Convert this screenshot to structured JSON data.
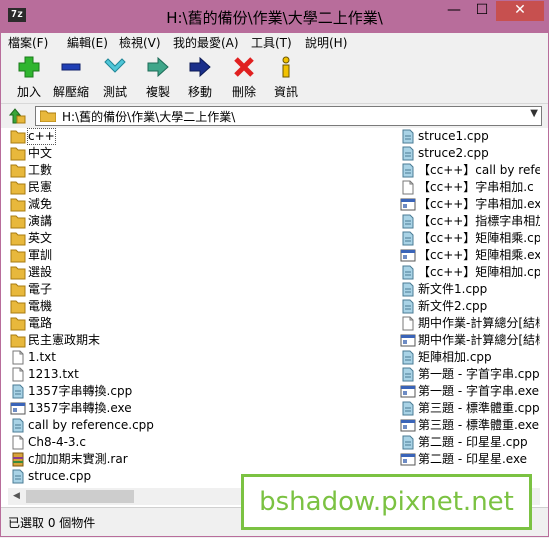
{
  "window": {
    "app_icon": "7z",
    "title": "H:\\舊的備份\\作業\\大學二上作業\\",
    "minimize": "—",
    "maximize": "☐",
    "close": "✕"
  },
  "menu": [
    "檔案(F)",
    "編輯(E)",
    "檢視(V)",
    "我的最愛(A)",
    "工具(T)",
    "說明(H)"
  ],
  "toolbar": [
    {
      "label": "加入",
      "icon": "add-icon"
    },
    {
      "label": "解壓縮",
      "icon": "extract-icon"
    },
    {
      "label": "測試",
      "icon": "test-icon"
    },
    {
      "label": "複製",
      "icon": "copy-icon"
    },
    {
      "label": "移動",
      "icon": "move-icon"
    },
    {
      "label": "刪除",
      "icon": "delete-icon"
    },
    {
      "label": "資訊",
      "icon": "info-icon"
    }
  ],
  "address": {
    "path": "H:\\舊的備份\\作業\\大學二上作業\\"
  },
  "files_left": [
    {
      "name": "c++",
      "type": "folder"
    },
    {
      "name": "中文",
      "type": "folder"
    },
    {
      "name": "工數",
      "type": "folder"
    },
    {
      "name": "民憲",
      "type": "folder"
    },
    {
      "name": "減免",
      "type": "folder"
    },
    {
      "name": "演講",
      "type": "folder"
    },
    {
      "name": "英文",
      "type": "folder"
    },
    {
      "name": "軍訓",
      "type": "folder"
    },
    {
      "name": "選設",
      "type": "folder"
    },
    {
      "name": "電子",
      "type": "folder"
    },
    {
      "name": "電機",
      "type": "folder"
    },
    {
      "name": "電路",
      "type": "folder"
    },
    {
      "name": "民主憲政期末",
      "type": "folder"
    },
    {
      "name": "1.txt",
      "type": "txt"
    },
    {
      "name": "1213.txt",
      "type": "txt"
    },
    {
      "name": "1357字串轉換.cpp",
      "type": "cpp"
    },
    {
      "name": "1357字串轉換.exe",
      "type": "exe"
    },
    {
      "name": "call by reference.cpp",
      "type": "cpp"
    },
    {
      "name": "Ch8-4-3.c",
      "type": "c"
    },
    {
      "name": "c加加期末實測.rar",
      "type": "rar"
    },
    {
      "name": "struce.cpp",
      "type": "cpp"
    }
  ],
  "files_right": [
    {
      "name": "struce1.cpp",
      "type": "cpp"
    },
    {
      "name": "struce2.cpp",
      "type": "cpp"
    },
    {
      "name": "【cc++】call by refere",
      "type": "cpp"
    },
    {
      "name": "【cc++】字串相加.c",
      "type": "c"
    },
    {
      "name": "【cc++】字串相加.exe",
      "type": "exe"
    },
    {
      "name": "【cc++】指標字串相加",
      "type": "cpp"
    },
    {
      "name": "【cc++】矩陣相乘.cpp",
      "type": "cpp"
    },
    {
      "name": "【cc++】矩陣相乘.exe",
      "type": "exe"
    },
    {
      "name": "【cc++】矩陣相加.cpp",
      "type": "cpp"
    },
    {
      "name": "新文件1.cpp",
      "type": "cpp"
    },
    {
      "name": "新文件2.cpp",
      "type": "cpp"
    },
    {
      "name": "期中作業-計算總分[結構",
      "type": "txt"
    },
    {
      "name": "期中作業-計算總分[結構",
      "type": "exe"
    },
    {
      "name": "矩陣相加.cpp",
      "type": "cpp"
    },
    {
      "name": "第一題 - 字首字串.cpp",
      "type": "cpp"
    },
    {
      "name": "第一題 - 字首字串.exe",
      "type": "exe"
    },
    {
      "name": "第三題 - 標準體重.cpp",
      "type": "cpp"
    },
    {
      "name": "第三題 - 標準體重.exe",
      "type": "exe"
    },
    {
      "name": "第二題 - 印星星.cpp",
      "type": "cpp"
    },
    {
      "name": "第二題 - 印星星.exe",
      "type": "exe"
    }
  ],
  "status": {
    "text": "已選取 0 個物件"
  },
  "watermark": {
    "text": "bshadow.pixnet.net"
  },
  "colors": {
    "titlebar": "#b86d9b",
    "close": "#c7504f",
    "folder": "#e8b83c",
    "watermark": "#7bc242"
  }
}
